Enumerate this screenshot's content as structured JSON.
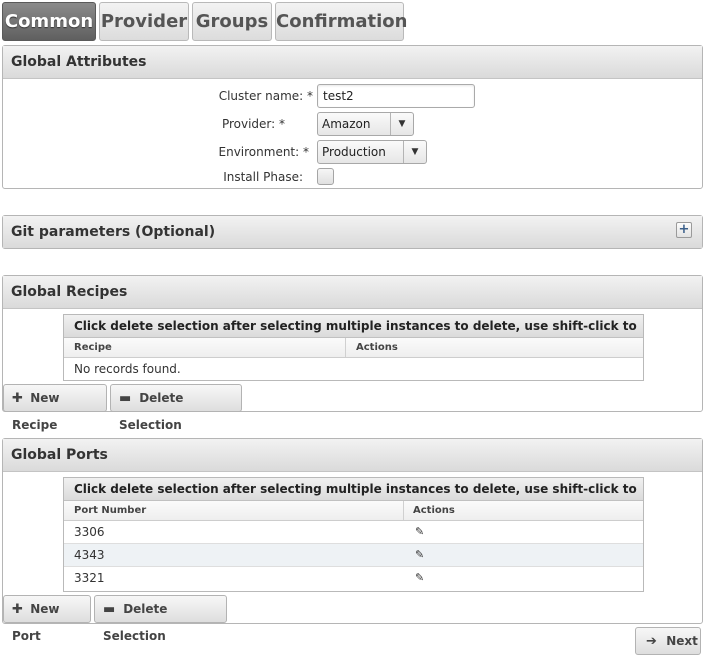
{
  "tabs": [
    {
      "label": "Common",
      "active": true
    },
    {
      "label": "Provider"
    },
    {
      "label": "Groups"
    },
    {
      "label": "Confirmation"
    }
  ],
  "global_attributes": {
    "title": "Global Attributes",
    "cluster_name_label": "Cluster name: *",
    "cluster_name_value": "test2",
    "provider_label": "Provider: *",
    "provider_value": "Amazon",
    "environment_label": "Environment: *",
    "environment_value": "Production",
    "install_phase_label": "Install Phase:"
  },
  "git_parameters": {
    "title": "Git parameters (Optional)",
    "expand_symbol": "+"
  },
  "global_recipes": {
    "title": "Global Recipes",
    "caption": "Click delete selection after selecting multiple instances to delete, use shift-click to select multiples",
    "columns": [
      "Recipe",
      "Actions"
    ],
    "empty_text": "No records found.",
    "new_button": "New Recipe",
    "delete_button": "Delete Selection"
  },
  "global_ports": {
    "title": "Global Ports",
    "caption": "Click delete selection after selecting multiple instances to delete, use shift-click to select multiples",
    "columns": [
      "Port Number",
      "Actions"
    ],
    "rows": [
      "3306",
      "4343",
      "3321"
    ],
    "new_button": "New Port",
    "delete_button": "Delete Selection"
  },
  "next_button": "Next",
  "icons": {
    "plus": "plus-icon",
    "minus": "minus-icon",
    "edit": "pencil-icon",
    "next": "arrow-right-icon",
    "dropdown": "chevron-down-icon"
  }
}
